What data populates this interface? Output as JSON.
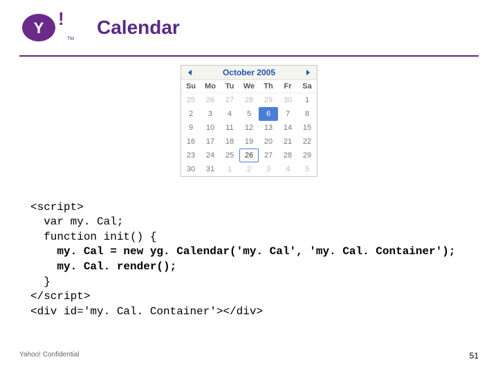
{
  "title": "Calendar",
  "logo_alt": "Yahoo! logo",
  "calendar": {
    "month_label": "October 2005",
    "day_headers": [
      "Su",
      "Mo",
      "Tu",
      "We",
      "Th",
      "Fr",
      "Sa"
    ],
    "cells": [
      {
        "n": "25",
        "oom": true
      },
      {
        "n": "26",
        "oom": true
      },
      {
        "n": "27",
        "oom": true
      },
      {
        "n": "28",
        "oom": true
      },
      {
        "n": "29",
        "oom": true
      },
      {
        "n": "30",
        "oom": true
      },
      {
        "n": "1"
      },
      {
        "n": "2"
      },
      {
        "n": "3"
      },
      {
        "n": "4"
      },
      {
        "n": "5"
      },
      {
        "n": "6",
        "selA": true
      },
      {
        "n": "7"
      },
      {
        "n": "8"
      },
      {
        "n": "9"
      },
      {
        "n": "10"
      },
      {
        "n": "11"
      },
      {
        "n": "12"
      },
      {
        "n": "13"
      },
      {
        "n": "14"
      },
      {
        "n": "15"
      },
      {
        "n": "16"
      },
      {
        "n": "17"
      },
      {
        "n": "18"
      },
      {
        "n": "19"
      },
      {
        "n": "20"
      },
      {
        "n": "21"
      },
      {
        "n": "22"
      },
      {
        "n": "23"
      },
      {
        "n": "24"
      },
      {
        "n": "25"
      },
      {
        "n": "26",
        "selB": true
      },
      {
        "n": "27"
      },
      {
        "n": "28"
      },
      {
        "n": "29"
      },
      {
        "n": "30"
      },
      {
        "n": "31"
      },
      {
        "n": "1",
        "oom": true
      },
      {
        "n": "2",
        "oom": true
      },
      {
        "n": "3",
        "oom": true
      },
      {
        "n": "4",
        "oom": true
      },
      {
        "n": "5",
        "oom": true
      }
    ]
  },
  "code": {
    "l1": "<script>",
    "l2": "  var my. Cal;",
    "l3": "  function init() {",
    "l4": "    my. Cal = new yg. Calendar('my. Cal', 'my. Cal. Container');",
    "l5": "    my. Cal. render();",
    "l6": "  }",
    "l7": "</script>",
    "l8": "<div id='my. Cal. Container'></div>"
  },
  "footer": {
    "left": "Yahoo! Confidential",
    "right": "51"
  }
}
